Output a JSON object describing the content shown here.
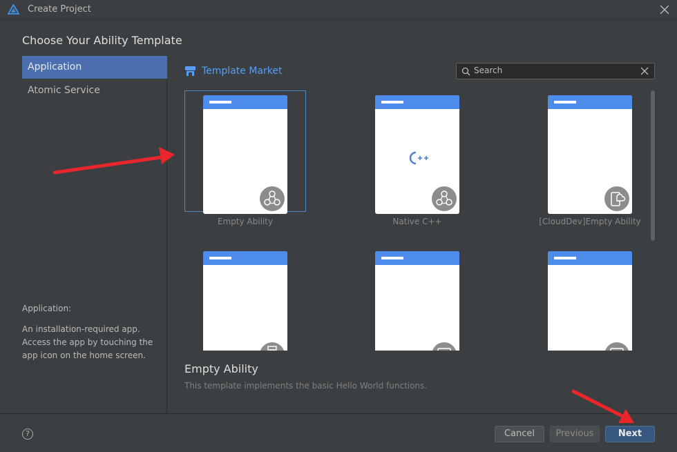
{
  "window": {
    "title": "Create Project"
  },
  "heading": "Choose Your Ability Template",
  "sidebar": {
    "items": [
      {
        "label": "Application",
        "selected": true
      },
      {
        "label": "Atomic Service",
        "selected": false
      }
    ],
    "description_title": "Application:",
    "description_body": "An installation-required app. Access the app by touching the app icon on the home screen."
  },
  "market": {
    "label": "Template Market"
  },
  "search": {
    "placeholder": "Search"
  },
  "templates": [
    {
      "label": "Empty Ability",
      "icon": "ability-icon",
      "selected": true
    },
    {
      "label": "Native C++",
      "icon": "ability-icon",
      "center_icon": "cpp-icon",
      "selected": false
    },
    {
      "label": "[CloudDev]Empty Ability",
      "icon": "cloud-device-icon",
      "selected": false
    },
    {
      "label": "",
      "icon": "watch-icon",
      "selected": false
    },
    {
      "label": "",
      "icon": "tablet-icon",
      "selected": false
    },
    {
      "label": "",
      "icon": "tablet-icon",
      "selected": false
    }
  ],
  "detail": {
    "title": "Empty Ability",
    "description": "This template implements the basic Hello World functions."
  },
  "footer": {
    "help": "?",
    "cancel": "Cancel",
    "previous": "Previous",
    "next": "Next"
  },
  "colors": {
    "background": "#3c3f41",
    "selection": "#4b6eaf",
    "accent": "#589df6",
    "phone_bar": "#4d8cea",
    "primary_button": "#365880",
    "annotation_arrow": "#e8262b"
  }
}
